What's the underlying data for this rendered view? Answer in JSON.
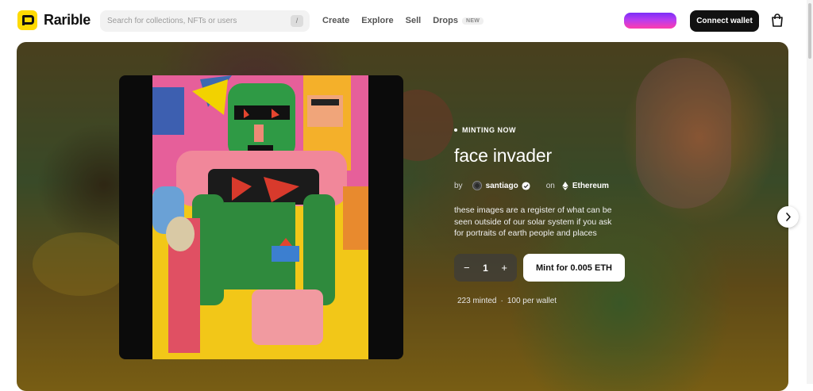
{
  "header": {
    "logo_text": "Rarible",
    "search_placeholder": "Search for collections, NFTs or users",
    "search_shortcut": "/",
    "nav": [
      {
        "label": "Create"
      },
      {
        "label": "Explore"
      },
      {
        "label": "Sell"
      },
      {
        "label": "Drops",
        "badge": "NEW"
      }
    ],
    "connect_label": "Connect wallet",
    "promo_color": "#b83cf0"
  },
  "drop": {
    "status": "MINTING NOW",
    "title": "face invader",
    "by_label": "by",
    "creator": "santiago",
    "on_label": "on",
    "chain": "Ethereum",
    "description": "these images are a register of what can be seen outside of our solar system if you ask for portraits of earth people and places",
    "quantity": "1",
    "minus": "−",
    "plus": "+",
    "mint_label": "Mint for 0.005 ETH",
    "minted": "223 minted",
    "separator": "·",
    "per_wallet": "100 per wallet"
  },
  "colors": {
    "logo_yellow": "#FEDA03",
    "primary_dark": "#111111"
  }
}
